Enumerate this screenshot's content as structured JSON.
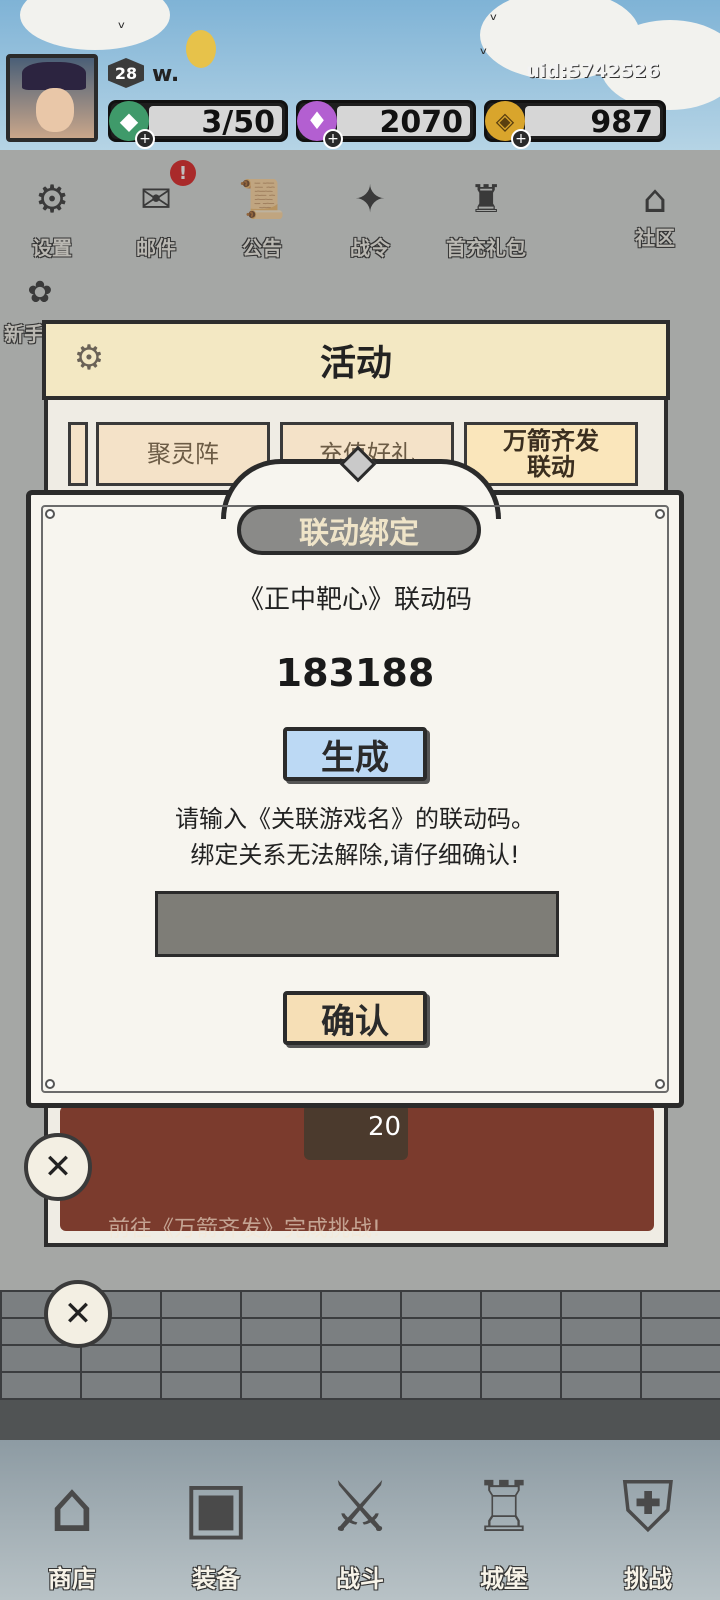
{
  "header": {
    "level": "28",
    "player_name": "w.",
    "uid": "uid:5742526",
    "resources": [
      {
        "name": "energy",
        "icon": "green-crystal-icon",
        "value": "3/50"
      },
      {
        "name": "gems",
        "icon": "purple-gem-icon",
        "value": "2070"
      },
      {
        "name": "coins",
        "icon": "gold-coin-icon",
        "value": "987"
      }
    ]
  },
  "menu": {
    "row1": [
      {
        "label": "设置",
        "icon": "gear-icon"
      },
      {
        "label": "邮件",
        "icon": "mail-icon",
        "badge": "!"
      },
      {
        "label": "公告",
        "icon": "scroll-icon"
      },
      {
        "label": "战令",
        "icon": "crystal-ball-icon"
      },
      {
        "label": "首充礼包",
        "icon": "gift-bag-icon"
      },
      {
        "label": "社区",
        "icon": "home-icon"
      }
    ],
    "row2_partial_label": "新手"
  },
  "activity": {
    "title": "活动",
    "tabs": [
      {
        "label": "聚灵阵",
        "active": false
      },
      {
        "label": "充值好礼",
        "active": false
      },
      {
        "label": "万箭齐发\n联动",
        "active": true
      }
    ],
    "reward_value": "20",
    "footer_text": "前往《万箭齐发》完成挑战!"
  },
  "dialog": {
    "title": "联动绑定",
    "code_label": "《正中靶心》联动码",
    "code_value": "183188",
    "generate_label": "生成",
    "instruction_line1": "请输入《关联游戏名》的联动码。",
    "instruction_line2": "绑定关系无法解除,请仔细确认!",
    "input_value": "",
    "input_placeholder": "",
    "confirm_label": "确认"
  },
  "bottom_nav": [
    {
      "label": "商店",
      "icon": "shop-hut-icon"
    },
    {
      "label": "装备",
      "icon": "backpack-icon"
    },
    {
      "label": "战斗",
      "icon": "crossed-swords-icon"
    },
    {
      "label": "城堡",
      "icon": "castle-icon"
    },
    {
      "label": "挑战",
      "icon": "shield-icon"
    }
  ],
  "colors": {
    "dialog_bg": "#f7f5ef",
    "generate_button": "#bcd9f4",
    "confirm_button": "#f6dfb6",
    "input_bg": "#7e7d77",
    "tab_active": "#fae6bb",
    "badge_red": "#dd2222"
  }
}
